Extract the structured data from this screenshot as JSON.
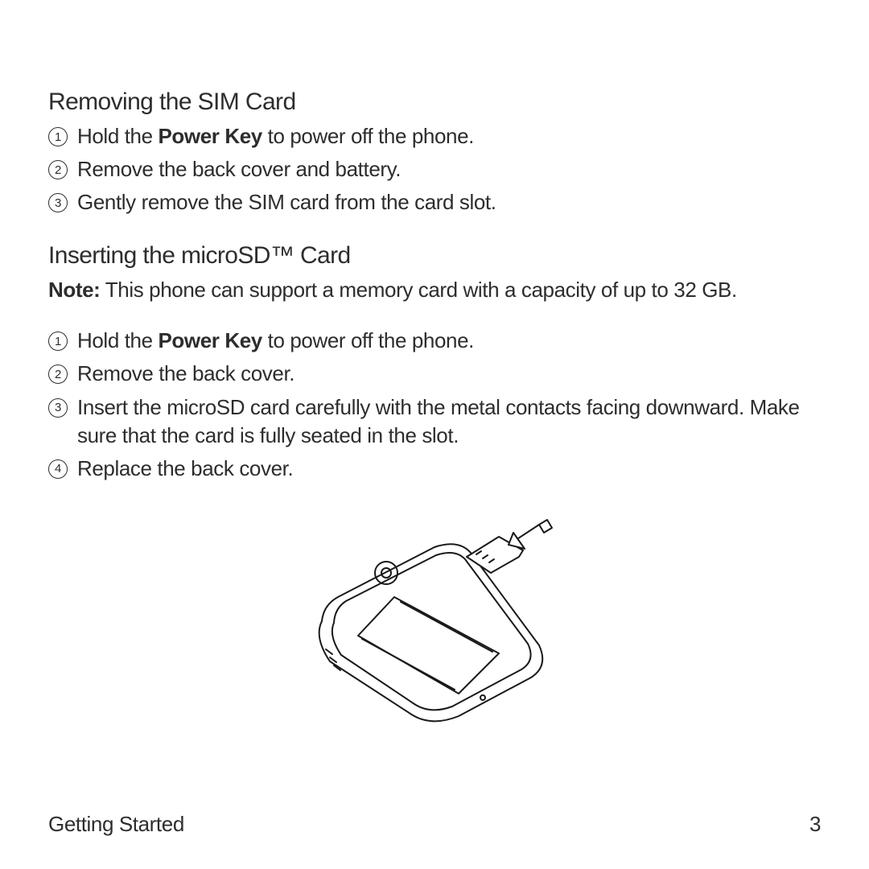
{
  "sections": [
    {
      "heading": "Removing the SIM Card",
      "steps": [
        {
          "num": "1",
          "prefix": "Hold the ",
          "bold": "Power Key",
          "suffix": " to power off the phone."
        },
        {
          "num": "2",
          "prefix": "Remove the back cover and battery.",
          "bold": "",
          "suffix": ""
        },
        {
          "num": "3",
          "prefix": "Gently remove the SIM card from the card slot.",
          "bold": "",
          "suffix": ""
        }
      ]
    },
    {
      "heading": "Inserting the microSD™ Card",
      "note_label": "Note:",
      "note_text": " This phone can support a memory card with a capacity of up to 32 GB.",
      "steps": [
        {
          "num": "1",
          "prefix": "Hold the ",
          "bold": "Power Key",
          "suffix": " to power off the phone."
        },
        {
          "num": "2",
          "prefix": "Remove the back cover.",
          "bold": "",
          "suffix": ""
        },
        {
          "num": "3",
          "prefix": "Insert the microSD card carefully with the metal contacts facing downward. Make sure that the card is fully seated in the slot.",
          "bold": "",
          "suffix": ""
        },
        {
          "num": "4",
          "prefix": "Replace the back cover.",
          "bold": "",
          "suffix": ""
        }
      ]
    }
  ],
  "footer": {
    "section_name": "Getting Started",
    "page_number": "3"
  }
}
